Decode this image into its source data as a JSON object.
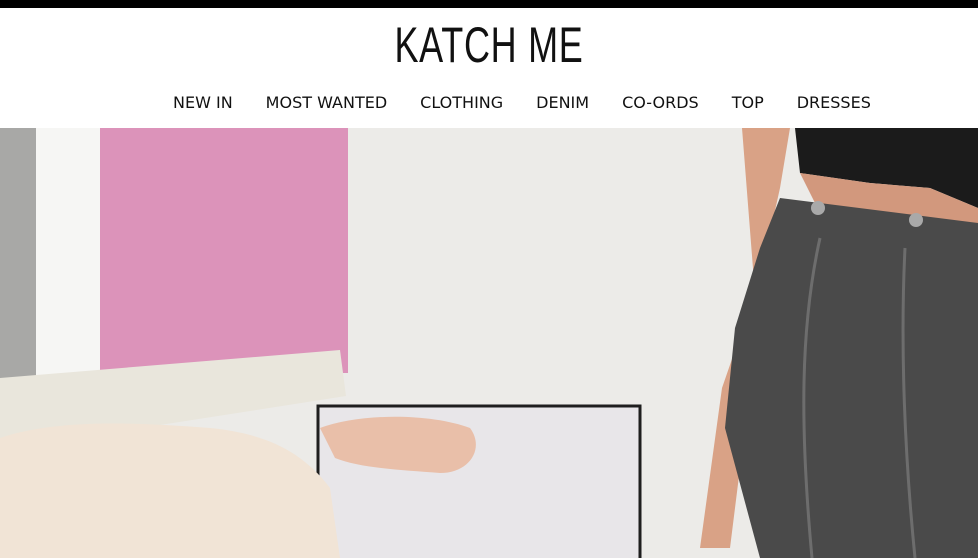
{
  "brand": {
    "logo_text": "KATCH ME"
  },
  "nav": {
    "items": [
      {
        "label": "NEW IN"
      },
      {
        "label": "MOST WANTED"
      },
      {
        "label": "CLOTHING"
      },
      {
        "label": "DENIM"
      },
      {
        "label": "CO-ORDS"
      },
      {
        "label": "TOP"
      },
      {
        "label": "DRESSES"
      }
    ]
  },
  "colors": {
    "top_bar": "#000000",
    "text": "#111111",
    "hero_pink": "#dc93ba",
    "hero_denim": "#4a4a4a"
  }
}
